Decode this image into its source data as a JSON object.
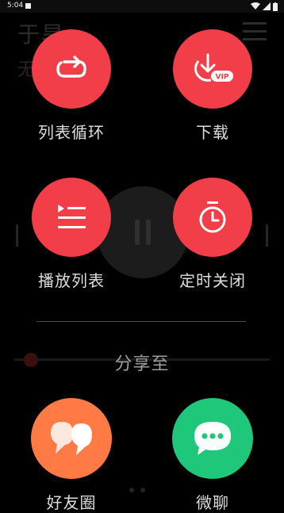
{
  "status_bar": {
    "time": "5:04"
  },
  "background_player": {
    "title": "于旱",
    "subtitle": "无"
  },
  "menu": {
    "items": [
      {
        "label": "列表循环",
        "icon": "repeat-icon"
      },
      {
        "label": "下载",
        "icon": "download-vip-icon",
        "badge": "VIP"
      },
      {
        "label": "播放列表",
        "icon": "playlist-icon"
      },
      {
        "label": "定时关闭",
        "icon": "timer-icon"
      }
    ]
  },
  "share": {
    "title": "分享至",
    "items": [
      {
        "label": "好友圈",
        "icon": "quote-bubbles-icon",
        "color": "#ff7a45"
      },
      {
        "label": "微聊",
        "icon": "chat-bubble-icon",
        "color": "#1fc77a"
      }
    ]
  },
  "colors": {
    "accent": "#f23e48",
    "background": "#000000"
  }
}
